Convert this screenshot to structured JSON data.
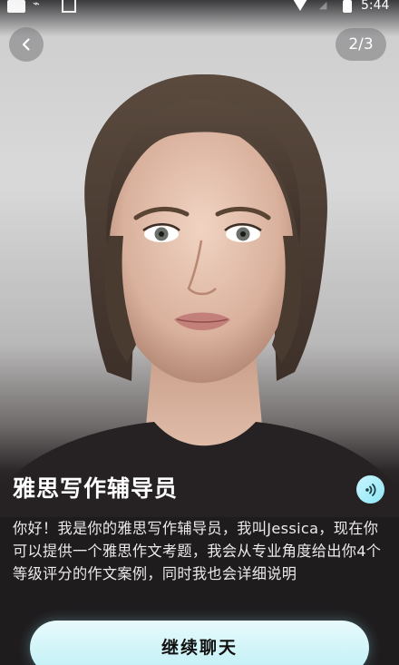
{
  "status_bar": {
    "time": "5:44"
  },
  "header": {
    "page_indicator": "2/3"
  },
  "icons": {
    "back": "chevron-left-icon",
    "voice": "sound-wave-icon"
  },
  "assistant": {
    "title": "雅思写作辅导员",
    "description": "你好！我是你的雅思写作辅导员，我叫Jessica，现在你可以提供一个雅思作文考题，我会从专业角度给出你4个等级评分的作文案例，同时我也会详细说明"
  },
  "actions": {
    "continue_label": "继续聊天"
  },
  "colors": {
    "accent": "#bdf0f5",
    "background": "#1f1c1e"
  }
}
